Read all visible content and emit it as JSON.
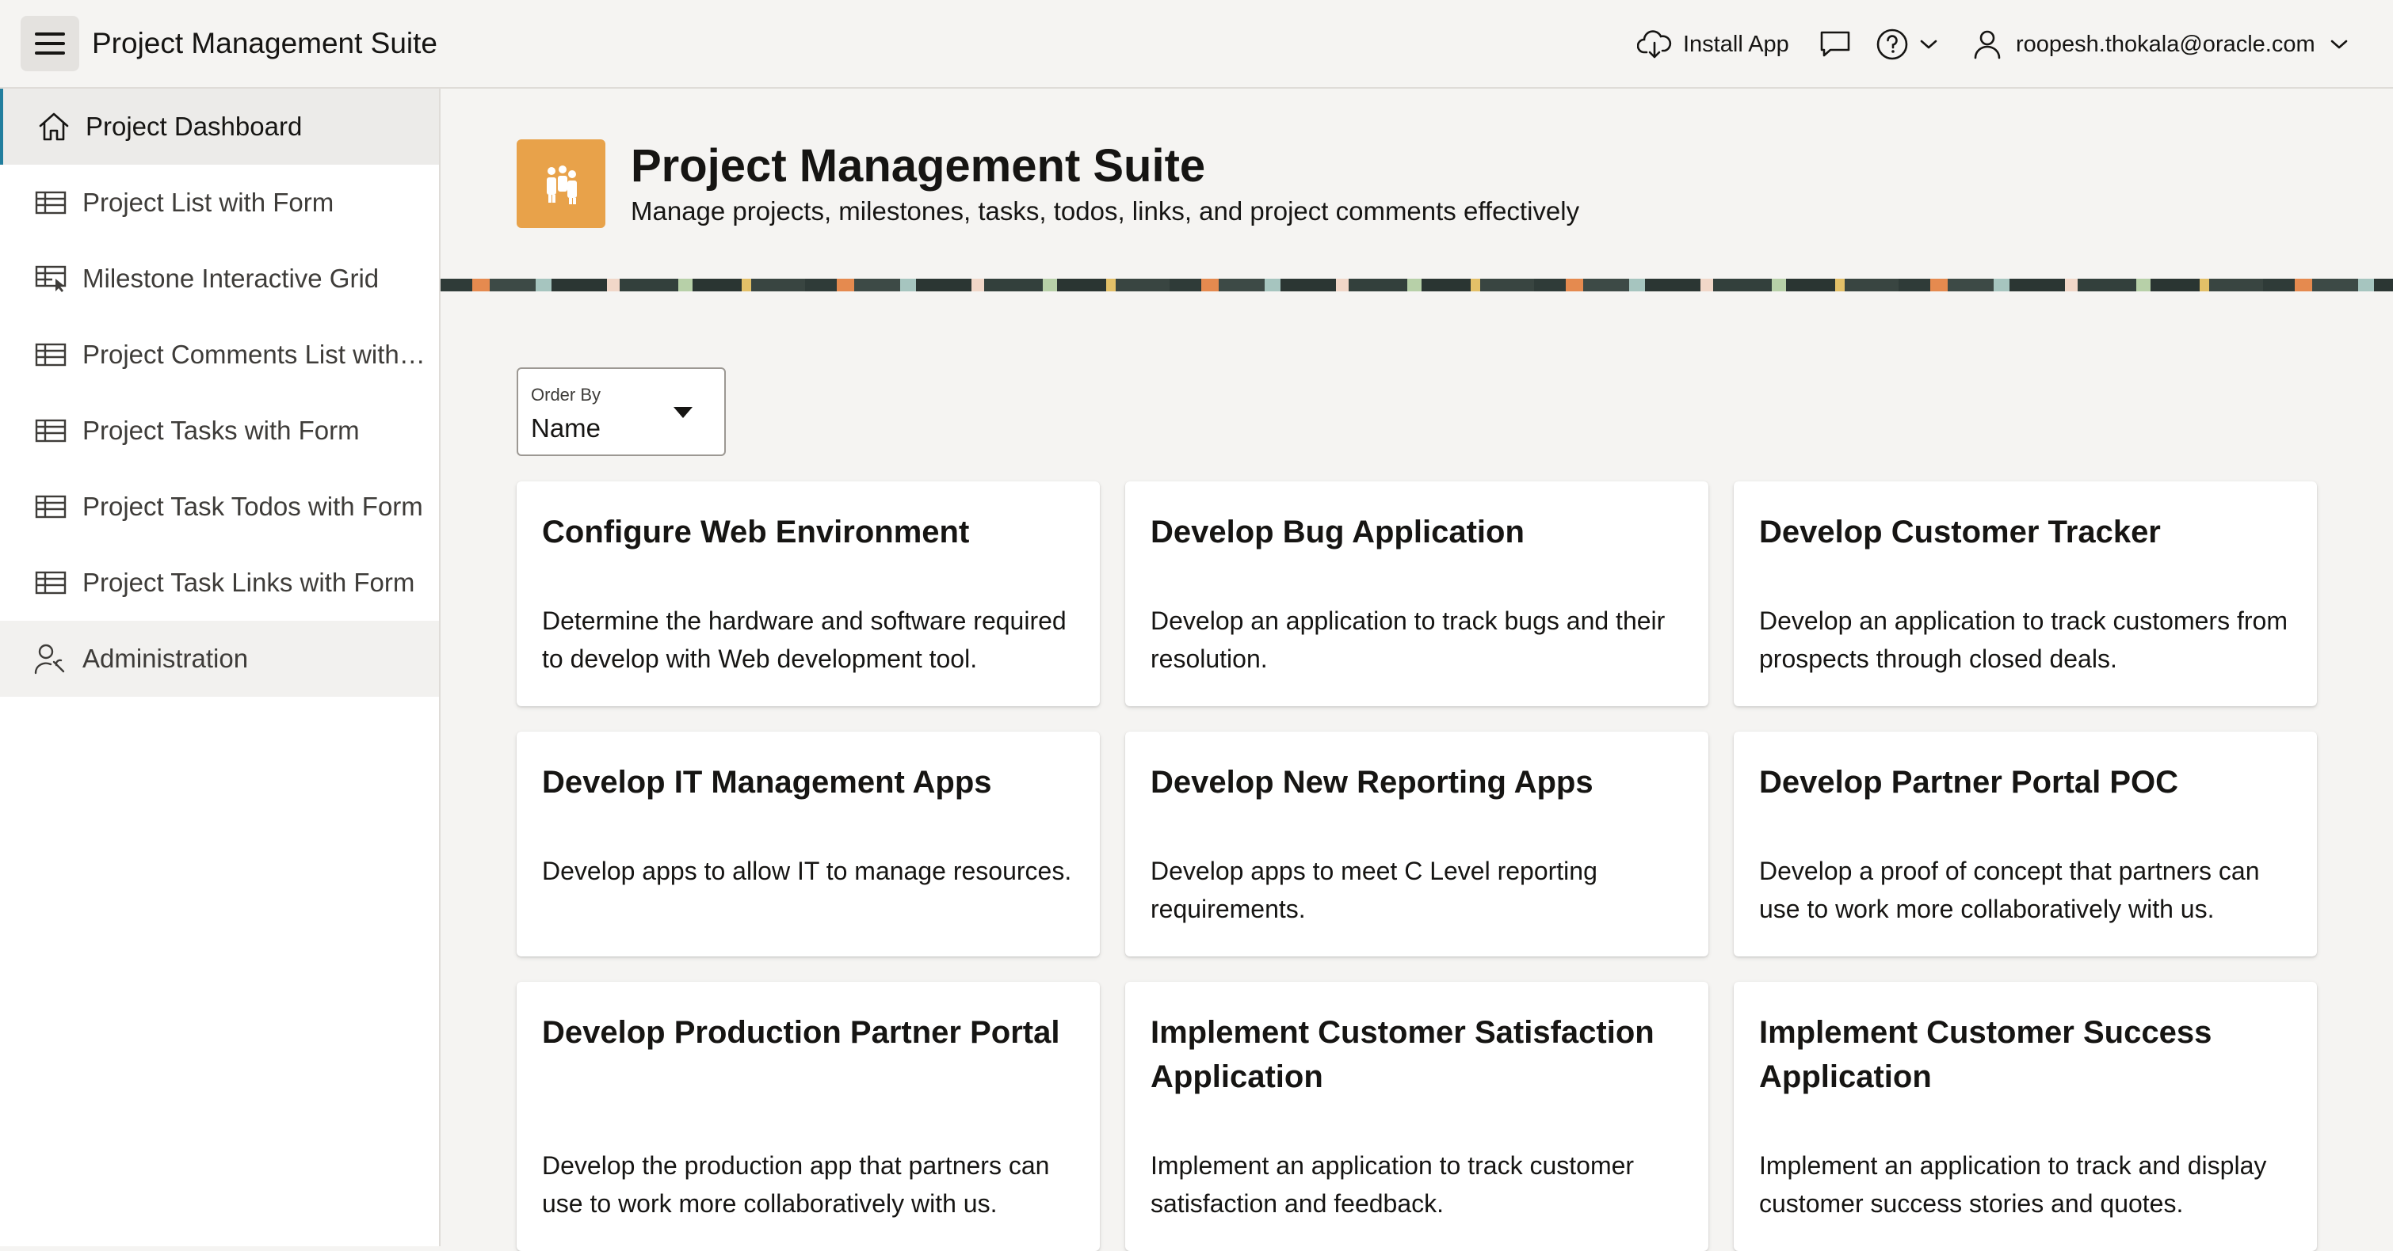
{
  "header": {
    "app_title": "Project Management Suite",
    "install_label": "Install App",
    "user_label": "roopesh.thokala@oracle.com"
  },
  "sidebar": {
    "items": [
      {
        "label": "Project Dashboard",
        "icon": "home-icon"
      },
      {
        "label": "Project List with Form",
        "icon": "table-icon"
      },
      {
        "label": "Milestone Interactive Grid",
        "icon": "interactive-grid-icon"
      },
      {
        "label": "Project Comments List with Form",
        "icon": "table-icon"
      },
      {
        "label": "Project Tasks with Form",
        "icon": "table-icon"
      },
      {
        "label": "Project Task Todos with Form",
        "icon": "table-icon"
      },
      {
        "label": "Project Task Links with Form",
        "icon": "table-icon"
      },
      {
        "label": "Administration",
        "icon": "wrench-user-icon"
      }
    ]
  },
  "hero": {
    "title": "Project Management Suite",
    "subtitle": "Manage projects, milestones, tasks, todos, links, and project comments effectively",
    "icon": "people-group-icon"
  },
  "order_by": {
    "label": "Order By",
    "value": "Name"
  },
  "cards": [
    {
      "title": "Configure Web Environment",
      "description": "Determine the hardware and software re­quired to develop with Web development tool."
    },
    {
      "title": "Develop Bug Application",
      "description": "Develop an application to track bugs and their resolution."
    },
    {
      "title": "Develop Customer Tracker",
      "description": "Develop an application to track customers from prospects through closed deals."
    },
    {
      "title": "Develop IT Management Apps",
      "description": "Develop apps to allow IT to manage resources."
    },
    {
      "title": "Develop New Reporting Apps",
      "description": "Develop apps to meet C Level reporting requirements."
    },
    {
      "title": "Develop Partner Portal POC",
      "description": "Develop a proof of concept that partners can use to work more collaboratively with us."
    },
    {
      "title": "Develop Production Partner Portal",
      "description": "Develop the production app that partners can use to work more collaboratively with us."
    },
    {
      "title": "Implement Customer Satisfaction Application",
      "description": "Implement an application to track customer satisfaction and feedback."
    },
    {
      "title": "Implement Customer Success Application",
      "description": "Implement an application to track and display customer success stories and quotes."
    }
  ],
  "colors": {
    "accent": "#227e9e",
    "hero_icon_bg": "#e8a24a",
    "page_bg": "#f5f4f2"
  }
}
